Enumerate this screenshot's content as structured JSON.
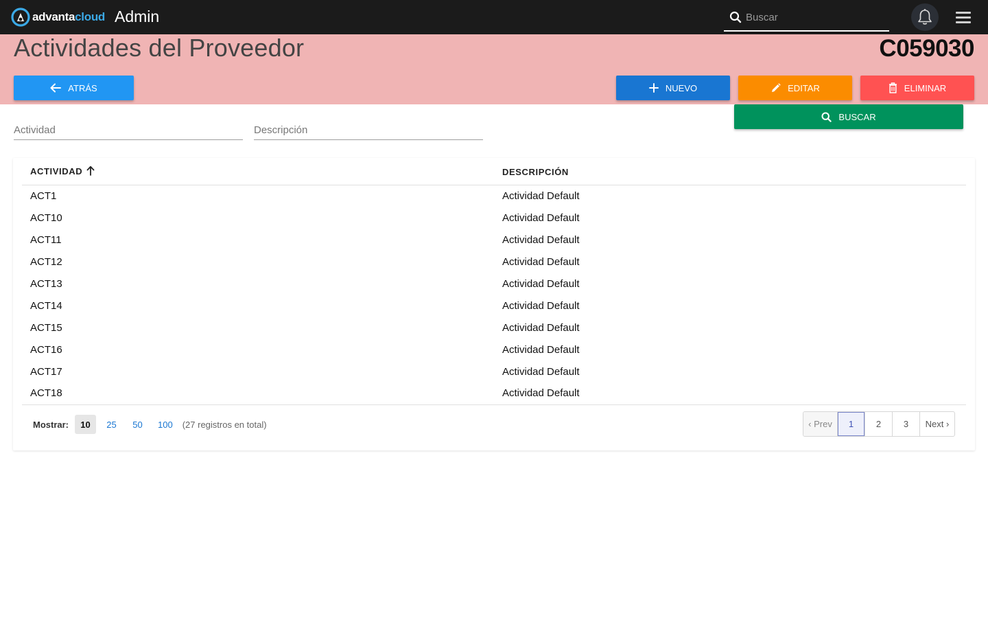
{
  "navbar": {
    "brand_a": "advanta",
    "brand_b": "cloud",
    "app_name": "Admin",
    "search_placeholder": "Buscar"
  },
  "header": {
    "title": "Actividades del Proveedor",
    "record_code": "C059030",
    "background": "#f0b4b4"
  },
  "actions": {
    "back": "ATRÁS",
    "new": "NUEVO",
    "edit": "EDITAR",
    "delete": "ELIMINAR",
    "search": "BUSCAR"
  },
  "filters": {
    "activity_placeholder": "Actividad",
    "description_placeholder": "Descripción"
  },
  "table": {
    "columns": [
      "ACTIVIDAD",
      "DESCRIPCIÓN"
    ],
    "sort": "activity-asc",
    "rows": [
      [
        "ACT1",
        "Actividad Default"
      ],
      [
        "ACT10",
        "Actividad Default"
      ],
      [
        "ACT11",
        "Actividad Default"
      ],
      [
        "ACT12",
        "Actividad Default"
      ],
      [
        "ACT13",
        "Actividad Default"
      ],
      [
        "ACT14",
        "Actividad Default"
      ],
      [
        "ACT15",
        "Actividad Default"
      ],
      [
        "ACT16",
        "Actividad Default"
      ],
      [
        "ACT17",
        "Actividad Default"
      ],
      [
        "ACT18",
        "Actividad Default"
      ]
    ]
  },
  "footer": {
    "show_label": "Mostrar:",
    "page_sizes": [
      "10",
      "25",
      "50",
      "100"
    ],
    "selected_size": "10",
    "total_text": "(27 registros en total)"
  },
  "pagination": {
    "prev": "‹ Prev",
    "pages": [
      "1",
      "2",
      "3"
    ],
    "current": "1",
    "next": "Next ›"
  },
  "colors": {
    "navbar": "#1b1b1b",
    "back": "#2196f3",
    "new": "#1976d2",
    "edit": "#fb8c00",
    "delete": "#ff5252",
    "search": "#00925c"
  }
}
